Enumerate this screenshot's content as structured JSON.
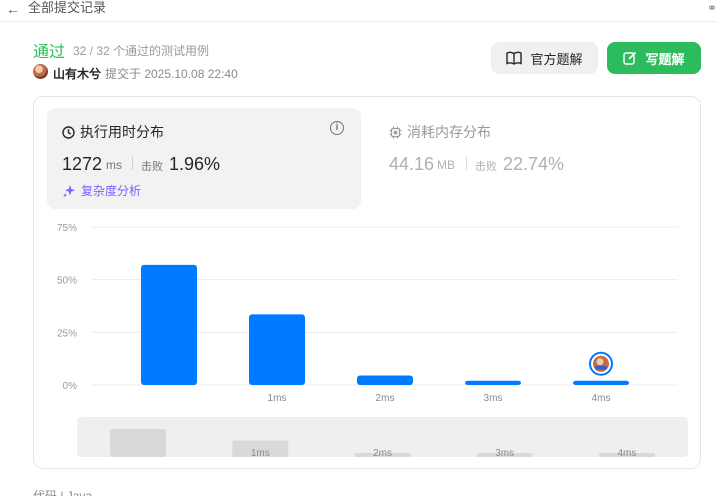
{
  "topbar": {
    "back_label": "全部提交记录"
  },
  "submission": {
    "status": "通过",
    "cases": "32 / 32 个通过的测试用例",
    "username": "山有木兮",
    "submitted": "提交于 2025.10.08 22:40"
  },
  "buttons": {
    "official_solution": "官方题解",
    "write_solution": "写题解"
  },
  "runtime": {
    "title": "执行用时分布",
    "value": "1272",
    "unit": "ms",
    "beats_label": "击败",
    "beats": "1.96%",
    "complexity_label": "复杂度分析"
  },
  "memory": {
    "title": "消耗内存分布",
    "value": "44.16",
    "unit": "MB",
    "beats_label": "击败",
    "beats": "22.74%"
  },
  "code": {
    "label": "代码 | Java"
  },
  "colors": {
    "accent_green": "#2cbb5d",
    "bar_blue": "#007aff",
    "purple": "#7b61ff"
  },
  "chart_data": {
    "type": "bar",
    "categories": [
      "",
      "1ms",
      "2ms",
      "3ms",
      "4ms"
    ],
    "values": [
      57,
      33.5,
      4.5,
      2,
      2
    ],
    "y_ticks": [
      "0%",
      "25%",
      "50%",
      "75%"
    ],
    "ylim": [
      0,
      75
    ],
    "highlight_category": "4ms",
    "minimap_values": [
      57,
      33.5,
      4.5,
      2,
      2
    ]
  }
}
